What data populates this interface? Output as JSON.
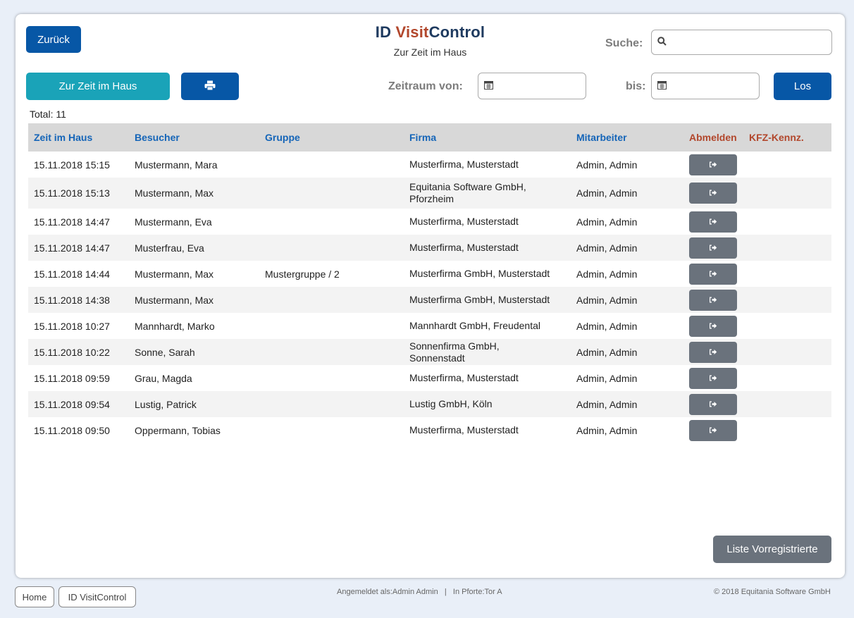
{
  "header": {
    "back_label": "Zurück",
    "logo_part1": "ID ",
    "logo_part2": "Visit",
    "logo_part3": "Control",
    "subtitle": "Zur Zeit im Haus",
    "search_label": "Suche:",
    "search_value": ""
  },
  "toolbar": {
    "current_label": "Zur Zeit im Haus",
    "print_icon": "printer-icon",
    "from_label": "Zeitraum von:",
    "to_label": "bis:",
    "go_label": "Los"
  },
  "total": "Total: 11",
  "table": {
    "columns": [
      "Zeit im Haus",
      "Besucher",
      "Gruppe",
      "Firma",
      "Mitarbeiter",
      "Abmelden",
      "KFZ-Kennz."
    ],
    "rows": [
      {
        "time": "15.11.2018 15:15",
        "visitor": "Mustermann, Mara",
        "group": "",
        "company": "Musterfirma, Musterstadt",
        "employee": "Admin, Admin",
        "plate": ""
      },
      {
        "time": "15.11.2018 15:13",
        "visitor": "Mustermann, Max",
        "group": "",
        "company": "Equitania Software GmbH, Pforzheim",
        "employee": "Admin, Admin",
        "plate": ""
      },
      {
        "time": "15.11.2018 14:47",
        "visitor": "Mustermann, Eva",
        "group": "",
        "company": "Musterfirma, Musterstadt",
        "employee": "Admin, Admin",
        "plate": ""
      },
      {
        "time": "15.11.2018 14:47",
        "visitor": "Musterfrau, Eva",
        "group": "",
        "company": "Musterfirma, Musterstadt",
        "employee": "Admin, Admin",
        "plate": ""
      },
      {
        "time": "15.11.2018 14:44",
        "visitor": "Mustermann, Max",
        "group": "Mustergruppe / 2",
        "company": "Musterfirma GmbH, Musterstadt",
        "employee": "Admin, Admin",
        "plate": ""
      },
      {
        "time": "15.11.2018 14:38",
        "visitor": "Mustermann, Max",
        "group": "",
        "company": "Musterfirma GmbH, Musterstadt",
        "employee": "Admin, Admin",
        "plate": ""
      },
      {
        "time": "15.11.2018 10:27",
        "visitor": "Mannhardt, Marko",
        "group": "",
        "company": "Mannhardt GmbH, Freudental",
        "employee": "Admin, Admin",
        "plate": ""
      },
      {
        "time": "15.11.2018 10:22",
        "visitor": "Sonne, Sarah",
        "group": "",
        "company": "Sonnenfirma GmbH, Sonnenstadt",
        "employee": "Admin, Admin",
        "plate": ""
      },
      {
        "time": "15.11.2018 09:59",
        "visitor": "Grau, Magda",
        "group": "",
        "company": "Musterfirma, Musterstadt",
        "employee": "Admin, Admin",
        "plate": ""
      },
      {
        "time": "15.11.2018 09:54",
        "visitor": "Lustig, Patrick",
        "group": "",
        "company": "Lustig GmbH, Köln",
        "employee": "Admin, Admin",
        "plate": ""
      },
      {
        "time": "15.11.2018 09:50",
        "visitor": "Oppermann, Tobias",
        "group": "",
        "company": "Musterfirma, Musterstadt",
        "employee": "Admin, Admin",
        "plate": ""
      }
    ]
  },
  "preregistered_label": "Liste Vorregistrierte",
  "footer": {
    "home_label": "Home",
    "app_label": "ID VisitControl",
    "logged_in": "Angemeldet als:Admin Admin   |   In Pforte:Tor A",
    "copyright": "© 2018 Equitania Software GmbH"
  },
  "colors": {
    "primary": "#0757a6",
    "teal": "#1aa3b8",
    "logo_dark": "#1e3a5f",
    "logo_red": "#b2472c",
    "button_gray": "#6a727c"
  }
}
